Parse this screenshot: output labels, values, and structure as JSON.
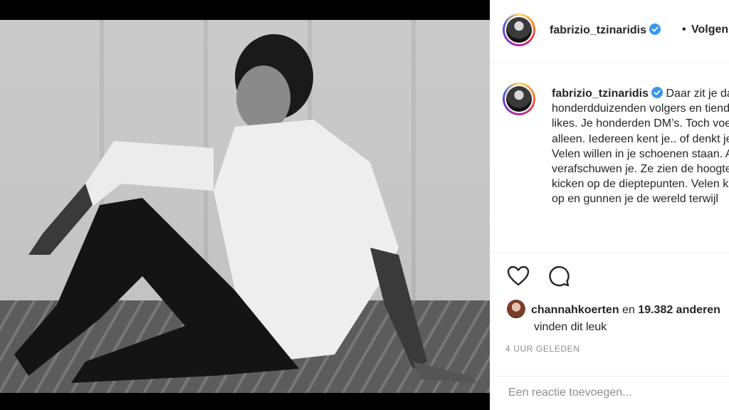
{
  "post": {
    "username": "fabrizio_tzinaridis",
    "follow_label": "Volgen",
    "separator": "•",
    "caption": "Daar zit je dan, met je honderdduizenden volgers en tienduizenden likes. Je honderden DM’s. Toch voelt het maar alleen. Iedereen kent je.. of denkt je te kennen. Velen willen in je schoenen staan. Anderen verafschuwen je. Ze zien de hoogtepunten, kicken op de dieptepunten. Velen kijken naar je op en gunnen je de wereld terwijl"
  },
  "likes": {
    "liker": "channahkoerten",
    "connector": "en",
    "count": "19.382 anderen",
    "suffix": "vinden dit leuk"
  },
  "timestamp": "4 UUR GELEDEN",
  "comment": {
    "placeholder": "Een reactie toevoegen..."
  },
  "icons": {
    "heart": "heart-icon",
    "comment": "comment-icon",
    "verified": "verified-badge-icon"
  },
  "colors": {
    "verified": "#3897f0",
    "text": "#262626",
    "muted": "#8e8e8e"
  }
}
